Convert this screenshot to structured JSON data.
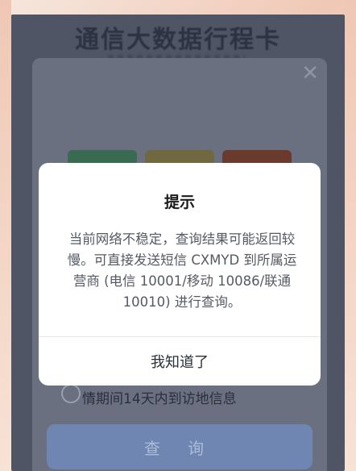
{
  "page": {
    "title": "通信大数据行程卡",
    "subtitle": ""
  },
  "form": {
    "close_icon": "close-icon",
    "operator_buttons": [
      "",
      "",
      ""
    ],
    "consent_text": "情期间14天内到访地信息",
    "query_button": "查 询"
  },
  "dialog": {
    "title": "提示",
    "message": "当前网络不稳定，查询结果可能返回较慢。可直接发送短信 CXMYD 到所属运营商 (电信 10001/移动 10086/联通 10010) 进行查询。",
    "confirm_button": "我知道了"
  },
  "colors": {
    "dialog_bg": "#ffffff",
    "overlay": "#4f5564",
    "query_button": "#6f86b3"
  }
}
